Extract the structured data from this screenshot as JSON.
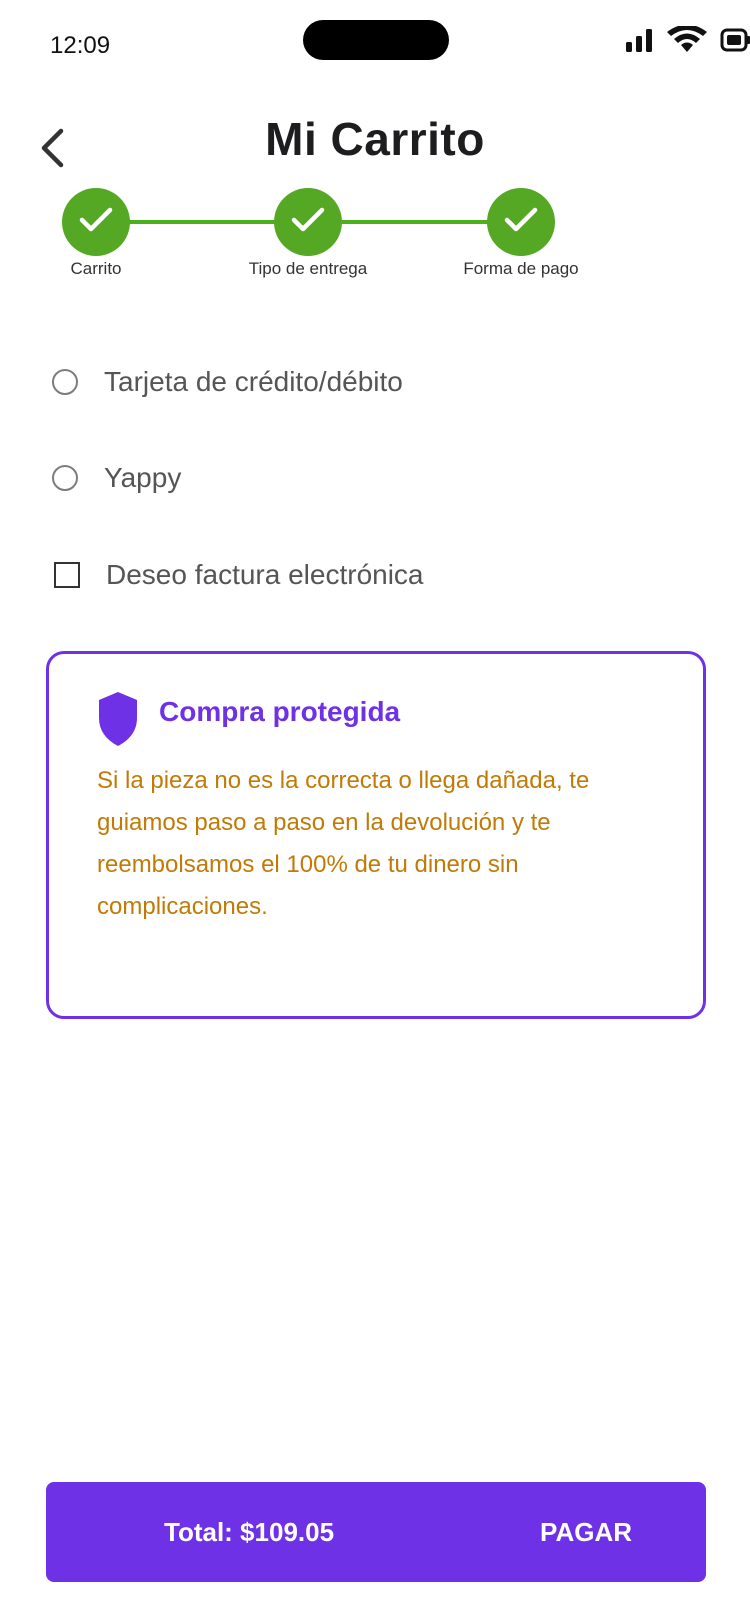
{
  "status_bar": {
    "time": "12:09",
    "icons": [
      "signal-icon",
      "wifi-icon",
      "battery-icon"
    ]
  },
  "header": {
    "title": "Mi Carrito",
    "back_icon": "chevron-left-icon"
  },
  "stepper": {
    "steps": [
      {
        "label": "Carrito",
        "completed": true
      },
      {
        "label": "Tipo de entrega",
        "completed": true
      },
      {
        "label": "Forma de pago",
        "completed": true
      }
    ],
    "color": "#55a823"
  },
  "payment_options": [
    {
      "label": "Tarjeta de crédito/débito",
      "type": "radio",
      "selected": false
    },
    {
      "label": "Yappy",
      "type": "radio",
      "selected": false
    }
  ],
  "invoice_option": {
    "label": "Deseo factura electrónica",
    "checked": false
  },
  "protection": {
    "title": "Compra protegida",
    "text": "Si la pieza no es la correcta o llega dañada, te guiamos paso a paso en la devolución y te reembolsamos el 100% de tu dinero sin complicaciones.",
    "icon": "shield-icon",
    "accent": "#6e31e6",
    "text_color": "#c27a07"
  },
  "footer": {
    "total": "Total: $109.05",
    "pay_label": "PAGAR",
    "bg_color": "#6e31e6"
  }
}
